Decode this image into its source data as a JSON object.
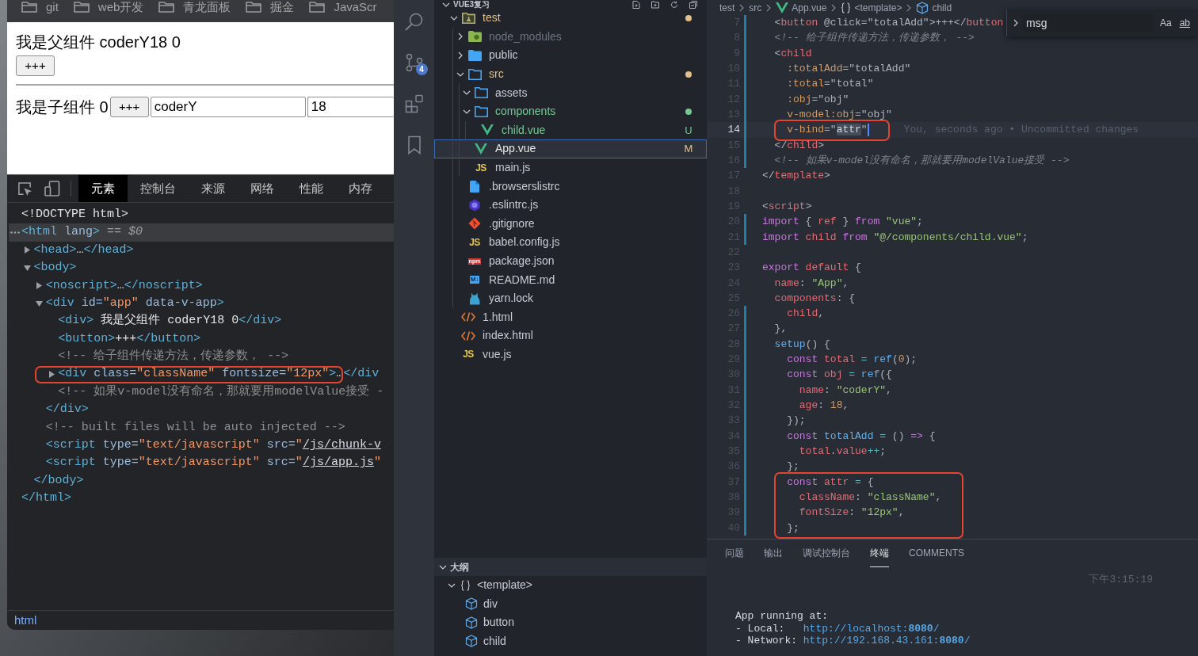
{
  "browser": {
    "bookmarks": [
      {
        "label": "git"
      },
      {
        "label": "web开发"
      },
      {
        "label": "青龙面板"
      },
      {
        "label": "掘金"
      },
      {
        "label": "JavaScr"
      }
    ],
    "page": {
      "parent_text": "我是父组件 coderY18 0",
      "parent_button": "+++",
      "child_text": "我是子组件 0",
      "child_button": "+++",
      "fields": [
        {
          "value": "coderY"
        },
        {
          "value": "18"
        }
      ]
    },
    "devtools": {
      "tabs": [
        {
          "label": "元素",
          "selected": true
        },
        {
          "label": "控制台",
          "selected": false
        },
        {
          "label": "来源",
          "selected": false
        },
        {
          "label": "网络",
          "selected": false
        },
        {
          "label": "性能",
          "selected": false
        },
        {
          "label": "内存",
          "selected": false
        }
      ],
      "dom": [
        {
          "tokens": [
            {
              "text": "<!DOCTYPE html>",
              "kind": "text"
            }
          ],
          "selected": false,
          "boxed": false
        },
        {
          "tokens": [
            {
              "text": "<html",
              "kind": "tag"
            },
            {
              "text": " lang",
              "kind": "attr"
            },
            {
              "text": ">",
              "kind": "tag"
            },
            {
              "text": " == ",
              "kind": "note"
            },
            {
              "text": "$0",
              "kind": "var"
            }
          ],
          "selected": true,
          "boxed": false,
          "children": [
            {
              "tokens": [
                {
                  "text": "<head>",
                  "kind": "tag"
                },
                {
                  "text": "…",
                  "kind": "text"
                },
                {
                  "text": "</head>",
                  "kind": "tag"
                }
              ],
              "expanded": false,
              "selected": false,
              "boxed": false
            },
            {
              "tokens": [
                {
                  "text": "<body>",
                  "kind": "tag"
                }
              ],
              "expanded": true,
              "selected": false,
              "boxed": false,
              "children": [
                {
                  "tokens": [
                    {
                      "text": "<noscript>",
                      "kind": "tag"
                    },
                    {
                      "text": "…",
                      "kind": "text"
                    },
                    {
                      "text": "</noscript>",
                      "kind": "tag"
                    }
                  ],
                  "expanded": false,
                  "selected": false,
                  "boxed": false
                },
                {
                  "tokens": [
                    {
                      "text": "<div",
                      "kind": "tag"
                    },
                    {
                      "text": " id=",
                      "kind": "attr"
                    },
                    {
                      "text": "\"app\"",
                      "kind": "value"
                    },
                    {
                      "text": " data-v-app",
                      "kind": "attr"
                    },
                    {
                      "text": ">",
                      "kind": "tag"
                    }
                  ],
                  "expanded": true,
                  "selected": false,
                  "boxed": false,
                  "children": [
                    {
                      "tokens": [
                        {
                          "text": "<div>",
                          "kind": "tag"
                        },
                        {
                          "text": " 我是父组件 coderY18 0",
                          "kind": "text"
                        },
                        {
                          "text": "</div>",
                          "kind": "tag"
                        }
                      ],
                      "selected": false,
                      "boxed": false
                    },
                    {
                      "tokens": [
                        {
                          "text": "<button>",
                          "kind": "tag"
                        },
                        {
                          "text": "+++",
                          "kind": "text"
                        },
                        {
                          "text": "</button>",
                          "kind": "tag"
                        }
                      ],
                      "selected": false,
                      "boxed": false
                    },
                    {
                      "tokens": [
                        {
                          "text": "<!-- 给子组件传递方法，传递参数， -->",
                          "kind": "comment"
                        }
                      ],
                      "selected": false,
                      "boxed": false
                    },
                    {
                      "tokens": [
                        {
                          "text": "<div",
                          "kind": "tag"
                        },
                        {
                          "text": " class=",
                          "kind": "attr"
                        },
                        {
                          "text": "\"className\"",
                          "kind": "value"
                        },
                        {
                          "text": " fontsize=",
                          "kind": "attr"
                        },
                        {
                          "text": "\"12px\"",
                          "kind": "value"
                        },
                        {
                          "text": ">",
                          "kind": "tag"
                        },
                        {
                          "text": "…",
                          "kind": "text"
                        }
                      ],
                      "close": "</div",
                      "expanded": false,
                      "selected": false,
                      "boxed": true
                    },
                    {
                      "tokens": [
                        {
                          "text": "<!-- 如果v-model没有命名，那就要用modelValue接受 -",
                          "kind": "comment"
                        }
                      ],
                      "selected": false,
                      "boxed": false
                    }
                  ]
                },
                {
                  "tokens": [
                    {
                      "text": "</div>",
                      "kind": "tag"
                    }
                  ],
                  "selected": false,
                  "boxed": false
                },
                {
                  "tokens": [
                    {
                      "text": "<!-- built files will be auto injected -->",
                      "kind": "comment"
                    }
                  ],
                  "selected": false,
                  "boxed": false
                },
                {
                  "tokens": [
                    {
                      "text": "<script",
                      "kind": "tag"
                    },
                    {
                      "text": " type=",
                      "kind": "attr"
                    },
                    {
                      "text": "\"text/javascript\"",
                      "kind": "value"
                    },
                    {
                      "text": " src=",
                      "kind": "attr"
                    },
                    {
                      "text": "\"",
                      "kind": "value"
                    },
                    {
                      "text": "/js/chunk-v",
                      "kind": "link"
                    }
                  ],
                  "selected": false,
                  "boxed": false
                },
                {
                  "tokens": [
                    {
                      "text": "<script",
                      "kind": "tag"
                    },
                    {
                      "text": " type=",
                      "kind": "attr"
                    },
                    {
                      "text": "\"text/javascript\"",
                      "kind": "value"
                    },
                    {
                      "text": " src=",
                      "kind": "attr"
                    },
                    {
                      "text": "\"",
                      "kind": "value"
                    },
                    {
                      "text": "/js/app.js",
                      "kind": "link"
                    },
                    {
                      "text": "\"",
                      "kind": "value"
                    }
                  ],
                  "selected": false,
                  "boxed": false
                }
              ]
            },
            {
              "tokens": [
                {
                  "text": "</body>",
                  "kind": "tag"
                }
              ],
              "selected": false,
              "boxed": false
            }
          ]
        },
        {
          "tokens": [
            {
              "text": "</html>",
              "kind": "tag"
            }
          ],
          "selected": false,
          "boxed": false
        }
      ],
      "breadcrumb": "html"
    }
  },
  "vscode": {
    "activity": [
      {
        "kind": "search"
      },
      {
        "kind": "scm",
        "count": "4"
      },
      {
        "kind": "extensions"
      },
      {
        "kind": "bookmarks"
      }
    ],
    "explorer": {
      "title": "VUE3复习",
      "expanded": true,
      "tree": [
        {
          "label": "test",
          "kind": "testfolder",
          "expanded": true,
          "color": "#e2c08d",
          "selected": false,
          "children": [
            {
              "label": "node_modules",
              "kind": "nodefolder",
              "expanded": false,
              "color": "#6c7480",
              "selected": false
            },
            {
              "label": "public",
              "kind": "folder",
              "expanded": false,
              "selected": false
            },
            {
              "label": "src",
              "kind": "folder",
              "expanded": true,
              "color": "#e2c08d",
              "selected": false,
              "children": [
                {
                  "label": "assets",
                  "kind": "folder",
                  "expanded": true,
                  "selected": false
                },
                {
                  "label": "components",
                  "kind": "folder",
                  "expanded": true,
                  "color": "#73c991",
                  "selected": false,
                  "children": [
                    {
                      "label": "child.vue",
                      "kind": "vue",
                      "color": "#73c991",
                      "badge": "U",
                      "selected": false
                    }
                  ]
                },
                {
                  "label": "App.vue",
                  "kind": "vue",
                  "color": "#e2c08d",
                  "badge": "M",
                  "selected": true
                },
                {
                  "label": "main.js",
                  "kind": "js",
                  "icon_text": "JS",
                  "selected": false
                }
              ]
            },
            {
              "label": ".browserslistrc",
              "kind": "config",
              "selected": false
            },
            {
              "label": ".eslintrc.js",
              "kind": "eslint",
              "selected": false
            },
            {
              "label": ".gitignore",
              "kind": "git",
              "selected": false
            },
            {
              "label": "babel.config.js",
              "kind": "js",
              "icon_text": "JS",
              "selected": false
            },
            {
              "label": "package.json",
              "kind": "npm",
              "icon_text": "npm",
              "selected": false
            },
            {
              "label": "README.md",
              "kind": "markdown",
              "icon_text": "M↓",
              "selected": false
            },
            {
              "label": "yarn.lock",
              "kind": "yarn",
              "selected": false
            }
          ]
        },
        {
          "label": "1.html",
          "kind": "html",
          "selected": false
        },
        {
          "label": "index.html",
          "kind": "html",
          "selected": false
        },
        {
          "label": "vue.js",
          "kind": "js",
          "icon_text": "JS",
          "selected": false
        }
      ]
    },
    "outline": {
      "title": "大纲",
      "expanded": true,
      "tree": [
        {
          "label": "<template>",
          "kind": "module",
          "expanded": true,
          "children": [
            {
              "label": "div",
              "kind": "element"
            },
            {
              "label": "button",
              "kind": "element"
            },
            {
              "label": "child",
              "kind": "element"
            }
          ]
        }
      ]
    },
    "breadcrumb": [
      {
        "label": "test",
        "kind": "folder"
      },
      {
        "label": "src",
        "kind": "folder"
      },
      {
        "label": "App.vue",
        "kind": "vue"
      },
      {
        "label": "<template>",
        "kind": "module"
      },
      {
        "label": "child",
        "kind": "element"
      }
    ],
    "find": {
      "value": "msg",
      "options": [
        {
          "label": "Aa",
          "kind": "case"
        },
        {
          "label": "ab",
          "kind": "word"
        }
      ]
    },
    "lines": [
      {
        "number": "7",
        "changed": true,
        "current": false,
        "boxed": false,
        "tokens": [
          {
            "text": "  <",
            "kind": "punct"
          },
          {
            "text": "button",
            "kind": "tag"
          },
          {
            "text": " @click=\"totalAdd\">+++</",
            "kind": "punct"
          },
          {
            "text": "button",
            "kind": "tag"
          }
        ]
      },
      {
        "number": "8",
        "changed": true,
        "current": false,
        "boxed": false,
        "tokens": [
          {
            "text": "  <!-- 给子组件传递方法，传递参数， -->",
            "kind": "comment"
          }
        ]
      },
      {
        "number": "9",
        "changed": true,
        "current": false,
        "boxed": false,
        "tokens": [
          {
            "text": "  <",
            "kind": "punct"
          },
          {
            "text": "child",
            "kind": "tag"
          }
        ]
      },
      {
        "number": "10",
        "changed": true,
        "current": false,
        "boxed": false,
        "tokens": [
          {
            "text": "    :totalAdd",
            "kind": "attr"
          },
          {
            "text": "=\"totalAdd\"",
            "kind": "punct"
          }
        ]
      },
      {
        "number": "11",
        "changed": true,
        "current": false,
        "boxed": false,
        "tokens": [
          {
            "text": "    :total",
            "kind": "attr"
          },
          {
            "text": "=\"total\"",
            "kind": "punct"
          }
        ]
      },
      {
        "number": "12",
        "changed": true,
        "current": false,
        "boxed": false,
        "tokens": [
          {
            "text": "    :obj",
            "kind": "attr"
          },
          {
            "text": "=\"obj\"",
            "kind": "punct"
          }
        ]
      },
      {
        "number": "13",
        "changed": true,
        "current": false,
        "boxed": false,
        "tokens": [
          {
            "text": "    v-model:obj",
            "kind": "attr"
          },
          {
            "text": "=\"obj\"",
            "kind": "punct"
          }
        ]
      },
      {
        "number": "14",
        "changed": true,
        "current": true,
        "boxed": true,
        "blame": "You, seconds ago • Uncommitted changes",
        "tokens": [
          {
            "text": "    v-bind",
            "kind": "attr"
          },
          {
            "text": "=\"",
            "kind": "punct"
          },
          {
            "text": "attr",
            "kind": "match"
          },
          {
            "text": "\"",
            "kind": "punct"
          }
        ]
      },
      {
        "number": "15",
        "changed": true,
        "current": false,
        "boxed": false,
        "tokens": [
          {
            "text": "  </",
            "kind": "punct"
          },
          {
            "text": "child",
            "kind": "tag"
          },
          {
            "text": ">",
            "kind": "punct"
          }
        ]
      },
      {
        "number": "16",
        "changed": true,
        "current": false,
        "boxed": false,
        "tokens": [
          {
            "text": "  <!-- 如果v-model没有命名，那就要用modelValue接受 -->",
            "kind": "comment"
          }
        ]
      },
      {
        "number": "17",
        "changed": false,
        "current": false,
        "boxed": false,
        "tokens": [
          {
            "text": "</",
            "kind": "punct"
          },
          {
            "text": "template",
            "kind": "tag"
          },
          {
            "text": ">",
            "kind": "punct"
          }
        ]
      },
      {
        "number": "18",
        "changed": false,
        "current": false,
        "boxed": false
      },
      {
        "number": "19",
        "changed": false,
        "current": false,
        "boxed": false,
        "tokens": [
          {
            "text": "<",
            "kind": "punct"
          },
          {
            "text": "script",
            "kind": "tag"
          },
          {
            "text": ">",
            "kind": "punct"
          }
        ]
      },
      {
        "number": "20",
        "changed": true,
        "current": false,
        "boxed": false,
        "tokens": [
          {
            "text": "import",
            "kind": "keyword"
          },
          {
            "text": " { ",
            "kind": "punct"
          },
          {
            "text": "ref",
            "kind": "variable"
          },
          {
            "text": " } ",
            "kind": "punct"
          },
          {
            "text": "from",
            "kind": "keyword"
          },
          {
            "text": " \"vue\"",
            "kind": "string"
          },
          {
            "text": ";",
            "kind": "punct"
          }
        ]
      },
      {
        "number": "21",
        "changed": true,
        "current": false,
        "boxed": false,
        "tokens": [
          {
            "text": "import",
            "kind": "keyword"
          },
          {
            "text": " child ",
            "kind": "variable"
          },
          {
            "text": "from",
            "kind": "keyword"
          },
          {
            "text": " \"@/components/child.vue\"",
            "kind": "string"
          },
          {
            "text": ";",
            "kind": "punct"
          }
        ]
      },
      {
        "number": "22",
        "changed": false,
        "current": false,
        "boxed": false
      },
      {
        "number": "23",
        "changed": false,
        "current": false,
        "boxed": false,
        "tokens": [
          {
            "text": "export",
            "kind": "keyword"
          },
          {
            "text": " default",
            "kind": "variable"
          },
          {
            "text": " {",
            "kind": "punct"
          }
        ]
      },
      {
        "number": "24",
        "changed": false,
        "current": false,
        "boxed": false,
        "tokens": [
          {
            "text": "  name",
            "kind": "variable"
          },
          {
            "text": ": ",
            "kind": "punct"
          },
          {
            "text": "\"App\"",
            "kind": "string"
          },
          {
            "text": ",",
            "kind": "punct"
          }
        ]
      },
      {
        "number": "25",
        "changed": false,
        "current": false,
        "boxed": false,
        "tokens": [
          {
            "text": "  components",
            "kind": "variable"
          },
          {
            "text": ": {",
            "kind": "punct"
          }
        ]
      },
      {
        "number": "26",
        "changed": true,
        "current": false,
        "boxed": false,
        "tokens": [
          {
            "text": "    child",
            "kind": "variable"
          },
          {
            "text": ",",
            "kind": "punct"
          }
        ]
      },
      {
        "number": "27",
        "changed": true,
        "current": false,
        "boxed": false,
        "tokens": [
          {
            "text": "  },",
            "kind": "punct"
          }
        ]
      },
      {
        "number": "28",
        "changed": true,
        "current": false,
        "boxed": false,
        "tokens": [
          {
            "text": "  setup",
            "kind": "function"
          },
          {
            "text": "() {",
            "kind": "punct"
          }
        ]
      },
      {
        "number": "29",
        "changed": true,
        "current": false,
        "boxed": false,
        "tokens": [
          {
            "text": "    const",
            "kind": "keyword"
          },
          {
            "text": " total ",
            "kind": "variable"
          },
          {
            "text": "=",
            "kind": "operator"
          },
          {
            "text": " ref",
            "kind": "function"
          },
          {
            "text": "(",
            "kind": "punct"
          },
          {
            "text": "0",
            "kind": "number"
          },
          {
            "text": ");",
            "kind": "punct"
          }
        ]
      },
      {
        "number": "30",
        "changed": true,
        "current": false,
        "boxed": false,
        "tokens": [
          {
            "text": "    const",
            "kind": "keyword"
          },
          {
            "text": " obj ",
            "kind": "variable"
          },
          {
            "text": "=",
            "kind": "operator"
          },
          {
            "text": " ref",
            "kind": "function"
          },
          {
            "text": "({",
            "kind": "punct"
          }
        ]
      },
      {
        "number": "31",
        "changed": true,
        "current": false,
        "boxed": false,
        "tokens": [
          {
            "text": "      name",
            "kind": "variable"
          },
          {
            "text": ": ",
            "kind": "punct"
          },
          {
            "text": "\"coderY\"",
            "kind": "string"
          },
          {
            "text": ",",
            "kind": "punct"
          }
        ]
      },
      {
        "number": "32",
        "changed": true,
        "current": false,
        "boxed": false,
        "tokens": [
          {
            "text": "      age",
            "kind": "variable"
          },
          {
            "text": ": ",
            "kind": "punct"
          },
          {
            "text": "18",
            "kind": "number"
          },
          {
            "text": ",",
            "kind": "punct"
          }
        ]
      },
      {
        "number": "33",
        "changed": true,
        "current": false,
        "boxed": false,
        "tokens": [
          {
            "text": "    });",
            "kind": "punct"
          }
        ]
      },
      {
        "number": "34",
        "changed": true,
        "current": false,
        "boxed": false,
        "tokens": [
          {
            "text": "    const",
            "kind": "keyword"
          },
          {
            "text": " totalAdd ",
            "kind": "function"
          },
          {
            "text": "=",
            "kind": "operator"
          },
          {
            "text": " () ",
            "kind": "punct"
          },
          {
            "text": "=>",
            "kind": "keyword"
          },
          {
            "text": " {",
            "kind": "punct"
          }
        ]
      },
      {
        "number": "35",
        "changed": true,
        "current": false,
        "boxed": false,
        "tokens": [
          {
            "text": "      total",
            "kind": "variable"
          },
          {
            "text": ".",
            "kind": "punct"
          },
          {
            "text": "value",
            "kind": "variable"
          },
          {
            "text": "++",
            "kind": "operator"
          },
          {
            "text": ";",
            "kind": "punct"
          }
        ]
      },
      {
        "number": "36",
        "changed": true,
        "current": false,
        "boxed": false,
        "tokens": [
          {
            "text": "    };",
            "kind": "punct"
          }
        ]
      },
      {
        "number": "37",
        "changed": true,
        "current": false,
        "boxed": true,
        "tokens": [
          {
            "text": "    const",
            "kind": "keyword"
          },
          {
            "text": " attr ",
            "kind": "variable"
          },
          {
            "text": "=",
            "kind": "operator"
          },
          {
            "text": " {",
            "kind": "punct"
          }
        ]
      },
      {
        "number": "38",
        "changed": true,
        "current": false,
        "boxed": true,
        "tokens": [
          {
            "text": "      className",
            "kind": "variable"
          },
          {
            "text": ": ",
            "kind": "punct"
          },
          {
            "text": "\"className\"",
            "kind": "string"
          },
          {
            "text": ",",
            "kind": "punct"
          }
        ]
      },
      {
        "number": "39",
        "changed": true,
        "current": false,
        "boxed": true,
        "tokens": [
          {
            "text": "      fontSize",
            "kind": "variable"
          },
          {
            "text": ": ",
            "kind": "punct"
          },
          {
            "text": "\"12px\"",
            "kind": "string"
          },
          {
            "text": ",",
            "kind": "punct"
          }
        ]
      },
      {
        "number": "40",
        "changed": true,
        "current": false,
        "boxed": true,
        "tokens": [
          {
            "text": "    };",
            "kind": "punct"
          }
        ]
      }
    ],
    "panel": {
      "tabs": [
        {
          "label": "问题",
          "selected": false
        },
        {
          "label": "输出",
          "selected": false
        },
        {
          "label": "调试控制台",
          "selected": false
        },
        {
          "label": "终端",
          "selected": true
        },
        {
          "label": "COMMENTS",
          "selected": false
        }
      ],
      "time": "下午3:15:19",
      "terminal": [
        {
          "kind": "text",
          "text": "App running at:"
        },
        {
          "kind": "url",
          "label": "- Local:",
          "url": "http://localhost:**8080**/"
        },
        {
          "kind": "url",
          "label": "- Network:",
          "url": "http://192.168.43.161:**8080**/"
        }
      ]
    }
  }
}
